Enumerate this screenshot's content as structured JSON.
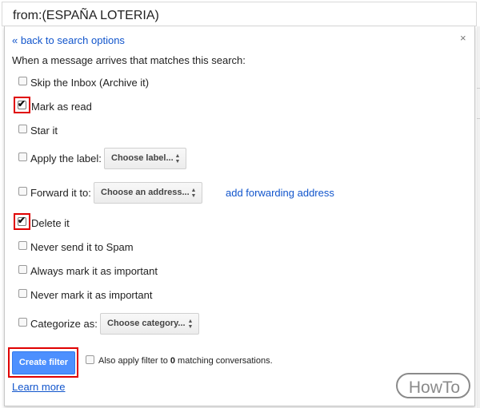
{
  "search": {
    "query": "from:(ESPAÑA LOTERIA)"
  },
  "panel": {
    "back_link": "« back to search options",
    "close": "×",
    "intro": "When a message arrives that matches this search:"
  },
  "options": [
    {
      "label": "Skip the Inbox (Archive it)",
      "checked": false
    },
    {
      "label": "Mark as read",
      "checked": true
    },
    {
      "label": "Star it",
      "checked": false
    },
    {
      "label": "Apply the label:",
      "checked": false,
      "select": "Choose label..."
    },
    {
      "label": "Forward it to:",
      "checked": false,
      "select": "Choose an address...",
      "link": "add forwarding address"
    },
    {
      "label": "Delete it",
      "checked": true
    },
    {
      "label": "Never send it to Spam",
      "checked": false
    },
    {
      "label": "Always mark it as important",
      "checked": false
    },
    {
      "label": "Never mark it as important",
      "checked": false
    },
    {
      "label": "Categorize as:",
      "checked": false,
      "select": "Choose category..."
    }
  ],
  "footer": {
    "create_button": "Create filter",
    "also_prefix": "Also apply filter to ",
    "also_count": "0",
    "also_suffix": " matching conversations.",
    "learn_more": "Learn more"
  },
  "check_glyph": "✔",
  "watermark": "HowTo",
  "colors": {
    "link": "#1155cc",
    "primary_button": "#4d90fe",
    "highlight": "#e00000"
  }
}
